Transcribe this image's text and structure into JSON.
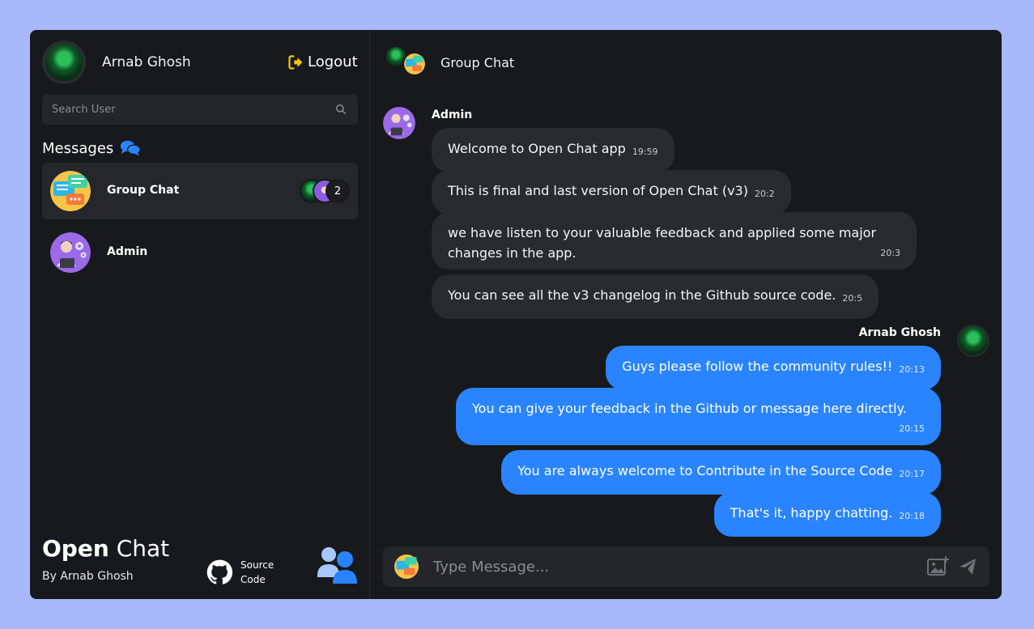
{
  "user": {
    "name": "Arnab Ghosh"
  },
  "logout_label": "Logout",
  "search": {
    "placeholder": "Search User"
  },
  "messages_heading": "Messages",
  "conversations": [
    {
      "name": "Group Chat",
      "member_count": "2",
      "active": true
    },
    {
      "name": "Admin",
      "active": false
    }
  ],
  "brand": {
    "bold": "Open",
    "light": "Chat",
    "byline": "By Arnab Ghosh"
  },
  "source": {
    "line1": "Source",
    "line2": "Code"
  },
  "chat": {
    "title": "Group Chat",
    "messages": [
      {
        "sender": "Admin",
        "text": "Welcome to Open Chat app",
        "time": "19:59",
        "dir": "in"
      },
      {
        "sender": "Admin",
        "text": "This is final and last version of Open Chat (v3)",
        "time": "20:2",
        "dir": "in"
      },
      {
        "sender": "Admin",
        "text": "we have listen to your valuable feedback and applied some major changes in the app.",
        "time": "20:3",
        "dir": "in"
      },
      {
        "sender": "Admin",
        "text": "You can see all the v3 changelog in the Github source code.",
        "time": "20:5",
        "dir": "in"
      },
      {
        "sender": "Arnab Ghosh",
        "text": "Guys please follow the community rules!!",
        "time": "20:13",
        "dir": "out"
      },
      {
        "sender": "Arnab Ghosh",
        "text": "You can give your feedback in the Github or message here directly.",
        "time": "20:15",
        "dir": "out"
      },
      {
        "sender": "Arnab Ghosh",
        "text": "You are always welcome to Contribute in the Source Code",
        "time": "20:17",
        "dir": "out"
      },
      {
        "sender": "Arnab Ghosh",
        "text": "That's it, happy chatting.",
        "time": "20:18",
        "dir": "out"
      }
    ],
    "sender_labels": {
      "admin": "Admin",
      "me": "Arnab Ghosh"
    }
  },
  "composer": {
    "placeholder": "Type Message..."
  },
  "colors": {
    "accent": "#2a84ff",
    "logout_icon": "#f6c90e",
    "page_bg": "#a8b8fb",
    "panel_bg": "#18191c"
  }
}
